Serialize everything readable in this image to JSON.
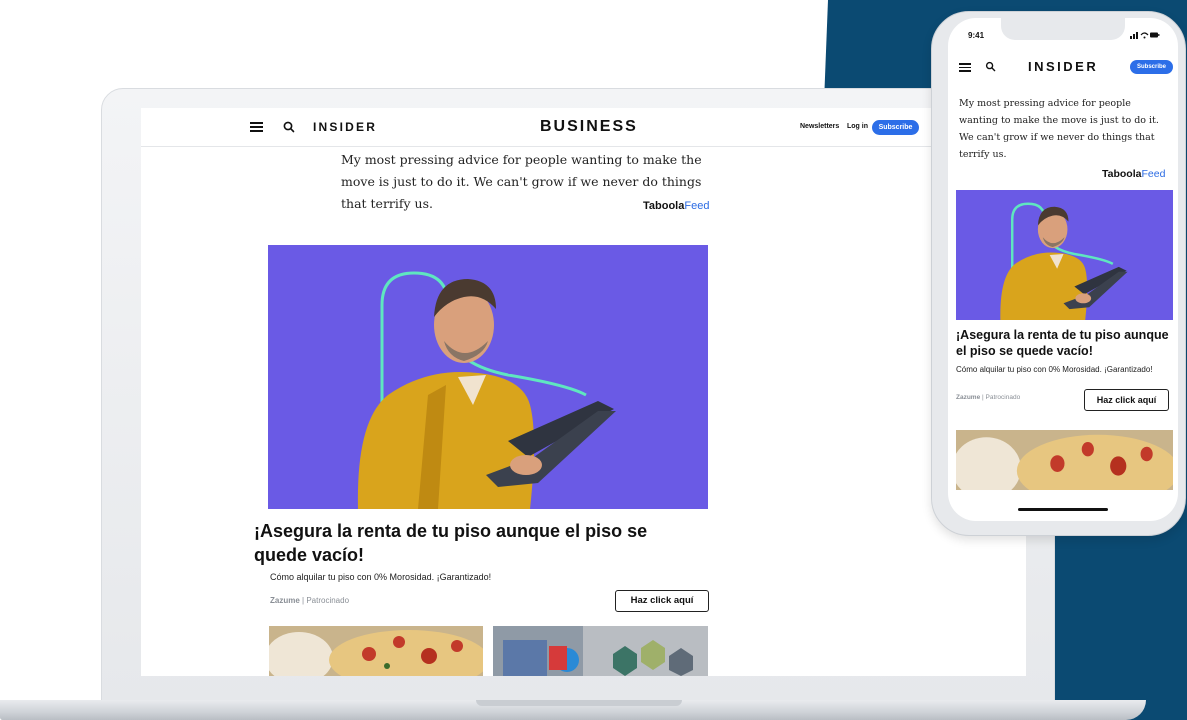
{
  "colors": {
    "navy": "#0b4a72",
    "hero_purple": "#6a5ae5",
    "subscribe_blue": "#2c6ee8",
    "taboola_blue": "#2b6be3",
    "shirt_yellow": "#d9a41c",
    "accent_teal": "#5fe6c0"
  },
  "laptop": {
    "header": {
      "menu_icon": "hamburger-icon",
      "search_icon": "search-icon",
      "logo": "INSIDER",
      "section": "BUSINESS",
      "newsletters": "Newsletters",
      "login": "Log in",
      "subscribe": "Subscribe"
    },
    "quote": "My most pressing advice for people wanting to make the move is just to do it. We can't grow if we never do things that terrify us.",
    "taboola": {
      "brand": "Taboola",
      "feed": "Feed"
    },
    "ad": {
      "headline": "¡Asegura la renta de tu piso aunque el piso se quede vacío!",
      "description": "Cómo alquilar tu piso con 0% Morosidad. ¡Garantizado!",
      "advertiser": "Zazume",
      "sponsored": "Patrocinado",
      "cta": "Haz click aquí"
    }
  },
  "phone": {
    "status": {
      "time": "9:41"
    },
    "header": {
      "menu_icon": "hamburger-icon",
      "search_icon": "search-icon",
      "logo": "INSIDER",
      "subscribe": "Subscribe"
    },
    "quote": "My most pressing advice for people wanting to make the move is just to do it. We can't grow if we never do things that terrify us.",
    "taboola": {
      "brand": "Taboola",
      "feed": "Feed"
    },
    "ad": {
      "headline": "¡Asegura la renta de tu piso aunque el piso se quede vacío!",
      "description": "Cómo alquilar tu piso con 0% Morosidad. ¡Garantizado!",
      "advertiser": "Zazume",
      "sponsored": "Patrocinado",
      "cta": "Haz click aquí"
    }
  }
}
